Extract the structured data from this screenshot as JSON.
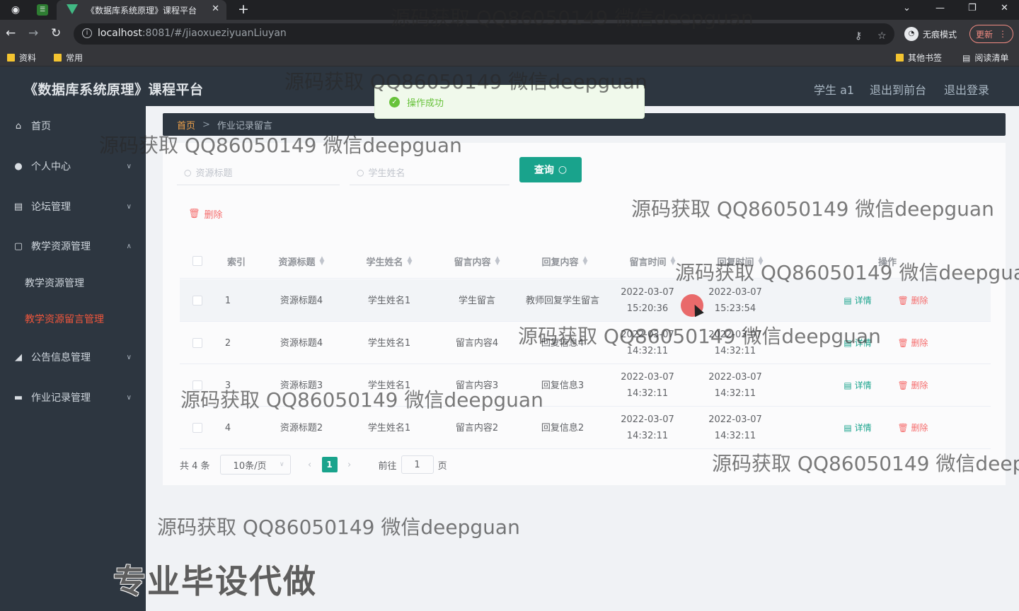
{
  "browser": {
    "tab_title": "《数据库系统原理》课程平台",
    "url_host": "localhost",
    "url_rest": ":8081/#/jiaoxueziyuanLiuyan",
    "incognito_label": "无痕模式",
    "update_label": "更新",
    "bookmarks": [
      "资料",
      "常用"
    ],
    "bookmarks_right": [
      "其他书签",
      "阅读清单"
    ]
  },
  "header": {
    "brand": "《数据库系统原理》课程平台",
    "user": "学生 a1",
    "back_front": "退出到前台",
    "logout": "退出登录"
  },
  "sidebar": {
    "items": [
      {
        "label": "首页",
        "icon": "home-icon"
      },
      {
        "label": "个人中心",
        "icon": "user-icon"
      },
      {
        "label": "论坛管理",
        "icon": "doc-icon"
      },
      {
        "label": "教学资源管理",
        "icon": "book-icon"
      },
      {
        "label": "公告信息管理",
        "icon": "notice-icon"
      },
      {
        "label": "作业记录管理",
        "icon": "work-icon"
      }
    ],
    "sub_items": [
      "教学资源管理",
      "教学资源留言管理"
    ]
  },
  "breadcrumb": {
    "home": "首页",
    "sep": ">",
    "current": "作业记录留言"
  },
  "toast": {
    "message": "操作成功",
    "color": "#67c23a"
  },
  "search": {
    "title_placeholder": "资源标题",
    "name_placeholder": "学生姓名",
    "query_label": "查询"
  },
  "actions": {
    "batch_delete": "删除"
  },
  "table": {
    "columns": [
      "索引",
      "资源标题",
      "学生姓名",
      "留言内容",
      "回复内容",
      "留言时间",
      "回复时间",
      "操作"
    ],
    "rows": [
      {
        "index": "1",
        "title": "资源标题4",
        "name": "学生姓名1",
        "content": "学生留言",
        "reply": "教师回复学生留言",
        "created": "2022-03-07 15:20:36",
        "replied": "2022-03-07 15:23:54"
      },
      {
        "index": "2",
        "title": "资源标题4",
        "name": "学生姓名1",
        "content": "留言内容4",
        "reply": "回复信息4",
        "created": "2022-03-07 14:32:11",
        "replied": "2022-03-07 14:32:11"
      },
      {
        "index": "3",
        "title": "资源标题3",
        "name": "学生姓名1",
        "content": "留言内容3",
        "reply": "回复信息3",
        "created": "2022-03-07 14:32:11",
        "replied": "2022-03-07 14:32:11"
      },
      {
        "index": "4",
        "title": "资源标题2",
        "name": "学生姓名1",
        "content": "留言内容2",
        "reply": "回复信息2",
        "created": "2022-03-07 14:32:11",
        "replied": "2022-03-07 14:32:11"
      }
    ],
    "detail_label": "详情",
    "delete_label": "删除"
  },
  "pagination": {
    "total": "共 4 条",
    "page_size": "10条/页",
    "current_page": "1",
    "goto_prefix": "前往",
    "goto_value": "1",
    "goto_suffix": "页"
  },
  "watermarks": {
    "text": "源码获取 QQ86050149 微信deepguan",
    "promo": "专业毕设代做"
  },
  "colors": {
    "accent": "#19a38c",
    "danger": "#f56c6c",
    "sidebar": "#2d3640"
  }
}
